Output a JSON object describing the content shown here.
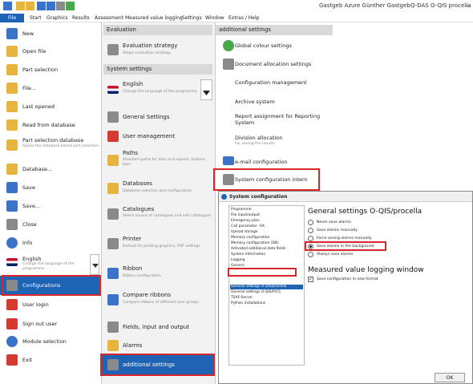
{
  "title_bar": {
    "title": "Gastgeb Azure Günther Gastgeb",
    "app": "Q-DAS O-QIS procella",
    "controls": "—"
  },
  "menu": [
    "File",
    "Start",
    "Graphics",
    "Results",
    "Assessment",
    "Measured value logging",
    "Settings",
    "Window",
    "Extras / Help"
  ],
  "left": {
    "items": [
      {
        "label": "New",
        "icon": "new-document-icon"
      },
      {
        "label": "Open file",
        "icon": "folder-icon"
      },
      {
        "label": "Part selection",
        "icon": "folder-icon"
      },
      {
        "label": "File...",
        "icon": "folder-icon"
      },
      {
        "label": "Last opened",
        "icon": "folder-star-icon"
      },
      {
        "label": "Read from database",
        "icon": "database-icon"
      },
      {
        "label": "Part selection database",
        "sub": "Opens the database based part selection",
        "icon": "database-icon"
      },
      {
        "label": "Database...",
        "icon": "database-icon"
      },
      {
        "label": "Save",
        "icon": "save-icon"
      },
      {
        "label": "Save...",
        "icon": "save-icon"
      },
      {
        "label": "Close",
        "icon": "close-document-icon"
      },
      {
        "label": "Info",
        "icon": "info-icon"
      },
      {
        "label": "English",
        "sub": "Change the language of the programme",
        "icon": "flag-icon"
      },
      {
        "label": "Configurations",
        "icon": "tools-icon"
      },
      {
        "label": "User login",
        "icon": "user-icon"
      },
      {
        "label": "Sign out user",
        "icon": "sign-out-icon"
      },
      {
        "label": "Module selection",
        "icon": "module-icon"
      },
      {
        "label": "Exit",
        "icon": "exit-icon"
      }
    ]
  },
  "middle": {
    "section1": "Evaluation",
    "section2": "System settings",
    "items": [
      {
        "label": "Evaluation strategy",
        "sub": "Adapt evaluation strategy"
      },
      {
        "label": "English",
        "sub": "Change the language of the programme"
      },
      {
        "label": "General Settings",
        "sub": ""
      },
      {
        "label": "User management",
        "sub": ""
      },
      {
        "label": "Paths",
        "sub": "Standard paths for data and reports, buttons bars"
      },
      {
        "label": "Databases",
        "sub": "Database selection and configuration"
      },
      {
        "label": "Catalogues",
        "sub": "Select source of catalogues and edit catalogues"
      },
      {
        "label": "Printer",
        "sub": "Default for printing graphics, PDF settings"
      },
      {
        "label": "Ribbon",
        "sub": "Ribbon configuration"
      },
      {
        "label": "Compare ribbons",
        "sub": "Compare ribbons of different user groups"
      },
      {
        "label": "Fields, input and output",
        "sub": ""
      },
      {
        "label": "Alarms",
        "sub": ""
      },
      {
        "label": "additional settings",
        "sub": ""
      }
    ]
  },
  "right": {
    "section": "additional settings",
    "items": [
      {
        "label": "Global colour settings",
        "sub": ""
      },
      {
        "label": "Document allocation settings",
        "sub": ""
      },
      {
        "label": "Configuration management",
        "sub": ""
      },
      {
        "label": "Archive system",
        "sub": ""
      },
      {
        "label": "Report assignment for Reporting System",
        "sub": ""
      },
      {
        "label": "Division allocation",
        "sub": "For saving the results"
      },
      {
        "label": "e-mail configuration",
        "sub": ""
      },
      {
        "label": "System configuration intern",
        "sub": ""
      }
    ]
  },
  "dialog": {
    "title": "System configuration",
    "list": [
      "Programme",
      "File input/output",
      "Emergency plan",
      "Call parameter -UX",
      "Upload storage",
      "Memory configuration",
      "Memory configuration (DB)",
      "Activated additional data fields",
      "System information",
      "Logging",
      "Generic",
      "General settings O-QIS/procella",
      "General settings O-QIS/P/CS",
      "TSAF-Server",
      "Python installations"
    ],
    "heading1": "General settings O-QIS/procella",
    "radios": [
      "Never save alarms",
      "Save alarms manually",
      "Force saving alarms manually",
      "Save alarms in the background",
      "Always save alarms"
    ],
    "selected_radio": 3,
    "heading2": "Measured value logging window",
    "checkbox": "Save configuration in new format",
    "ok": "OK"
  },
  "colors": {
    "accent": "#1f63b5",
    "highlight": "#d9262b"
  }
}
